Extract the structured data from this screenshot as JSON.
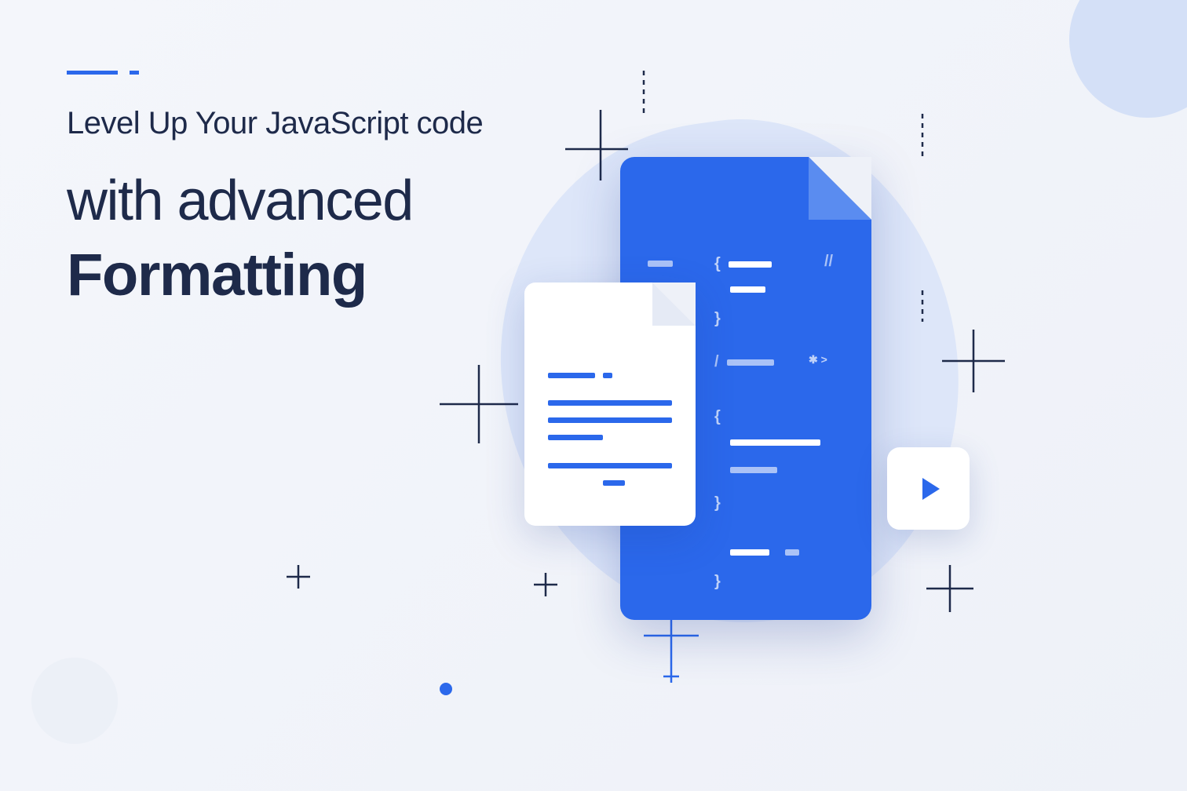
{
  "headline": {
    "line1": "Level Up Your JavaScript code",
    "line2": "with advanced",
    "line3": "Formatting"
  },
  "colors": {
    "primary": "#2b68eb",
    "text": "#1e2a4a",
    "bg": "#f4f6fb",
    "blob": "#dde6f9"
  },
  "icons": {
    "play": "play-icon",
    "document_code": "code-document-icon",
    "document_text": "text-document-icon"
  }
}
